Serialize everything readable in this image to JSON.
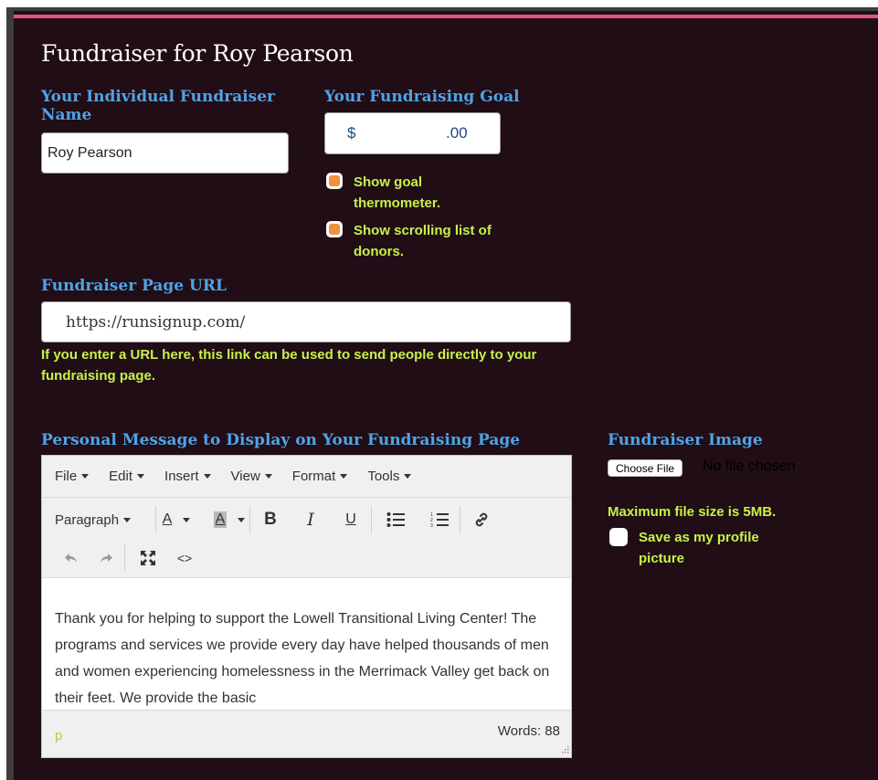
{
  "page": {
    "title": "Fundraiser for Roy Pearson"
  },
  "fundraiser_name": {
    "label": "Your Individual Fundraiser Name",
    "value": "Roy Pearson"
  },
  "goal": {
    "label": "Your Fundraising Goal",
    "prefix": "$",
    "suffix": ".00",
    "show_thermometer_label": "Show goal thermometer.",
    "show_donors_label": "Show scrolling list of donors."
  },
  "page_url": {
    "label": "Fundraiser Page URL",
    "value": "https://runsignup.com/",
    "help": "If you enter a URL here, this link can be used to send people directly to your fundraising page."
  },
  "message": {
    "label": "Personal Message to Display on Your Fundraising Page",
    "menus": [
      "File",
      "Edit",
      "Insert",
      "View",
      "Format",
      "Tools"
    ],
    "block_format": "Paragraph",
    "text": "Thank you for helping to support the Lowell Transitional Living Center! The programs and services we provide every day have helped thousands of men and women experiencing homelessness in the Merrimack Valley get back on their feet. We provide the basic",
    "path": "p",
    "word_count": "Words: 88"
  },
  "image": {
    "label": "Fundraiser Image",
    "choose_file": "Choose File",
    "no_file": "No file chosen",
    "max_size": "Maximum file size is 5MB.",
    "profile_label": "Save as my profile picture"
  },
  "colors": {
    "background": "#210d15",
    "accent_pink": "#e35383",
    "label_blue": "#4fa3e6",
    "help_green": "#c7f24a",
    "checkbox_orange": "#f0913f"
  }
}
